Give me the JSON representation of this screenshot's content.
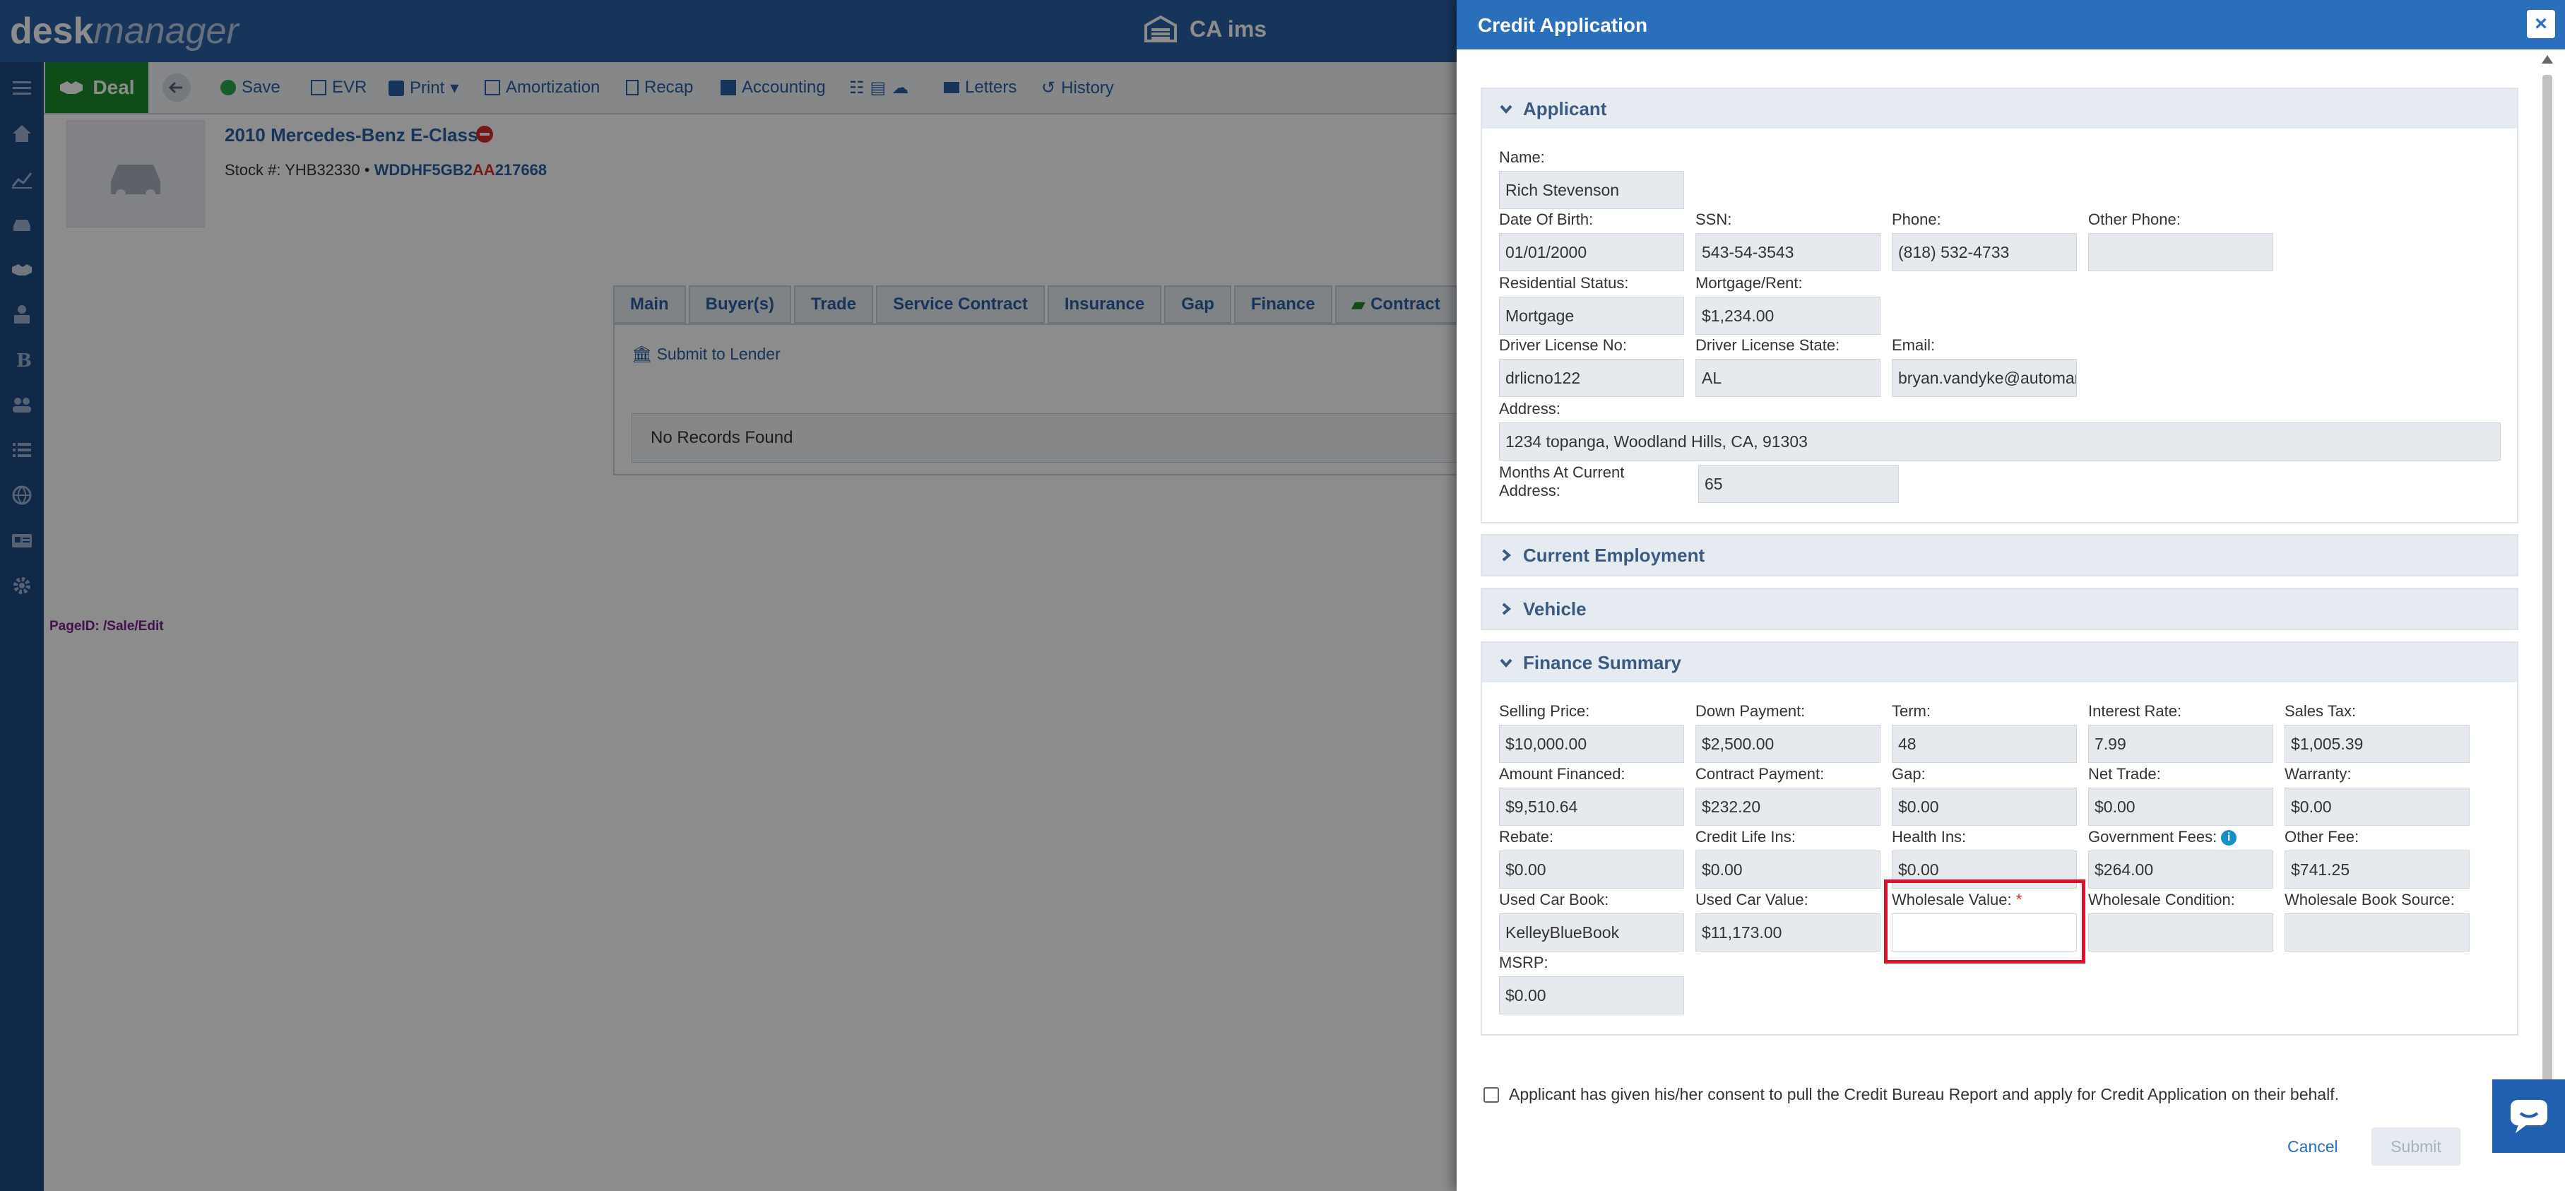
{
  "app": {
    "logo_bold": "desk",
    "logo_light": "manager",
    "dealer_name": "CA ims"
  },
  "actionbar": {
    "deal": "Deal",
    "save": "Save",
    "evr": "EVR",
    "print": "Print",
    "amortization": "Amortization",
    "recap": "Recap",
    "accounting": "Accounting",
    "letters": "Letters",
    "history": "History"
  },
  "vehicle": {
    "title": "2010 Mercedes-Benz E-Class",
    "stock_label": "Stock #:",
    "stock": "YHB32330",
    "vin_a": "WDDHF5GB2",
    "vin_b": "AA",
    "vin_c": "217668"
  },
  "tabs": [
    "Main",
    "Buyer(s)",
    "Trade",
    "Service Contract",
    "Insurance",
    "Gap",
    "Finance",
    "Contract"
  ],
  "tab_panel": {
    "submit_to_lender": "Submit to Lender",
    "no_records": "No Records Found"
  },
  "page_id": "PageID:  /Sale/Edit",
  "modal": {
    "title": "Credit Application",
    "close": "×",
    "sections": {
      "applicant": "Applicant",
      "current_employment": "Current Employment",
      "vehicle": "Vehicle",
      "finance_summary": "Finance Summary"
    },
    "applicant": {
      "name_label": "Name:",
      "name": "Rich  Stevenson",
      "dob_label": "Date Of Birth:",
      "dob": "01/01/2000",
      "ssn_label": "SSN:",
      "ssn": "543-54-3543",
      "phone_label": "Phone:",
      "phone": "(818) 532-4733",
      "other_phone_label": "Other Phone:",
      "other_phone": "",
      "residential_label": "Residential Status:",
      "residential": "Mortgage",
      "mortgage_label": "Mortgage/Rent:",
      "mortgage": "$1,234.00",
      "dl_no_label": "Driver License No:",
      "dl_no": "drlicno122",
      "dl_state_label": "Driver License State:",
      "dl_state": "AL",
      "email_label": "Email:",
      "email": "bryan.vandyke@automar",
      "address_label": "Address:",
      "address": "1234 topanga, Woodland Hills, CA, 91303",
      "months_label_1": "Months At Current",
      "months_label_2": "Address:",
      "months": "65"
    },
    "finance": {
      "selling_price_label": "Selling Price:",
      "selling_price": "$10,000.00",
      "down_payment_label": "Down Payment:",
      "down_payment": "$2,500.00",
      "term_label": "Term:",
      "term": "48",
      "interest_rate_label": "Interest Rate:",
      "interest_rate": "7.99",
      "sales_tax_label": "Sales Tax:",
      "sales_tax": "$1,005.39",
      "amount_financed_label": "Amount Financed:",
      "amount_financed": "$9,510.64",
      "contract_payment_label": "Contract Payment:",
      "contract_payment": "$232.20",
      "gap_label": "Gap:",
      "gap": "$0.00",
      "net_trade_label": "Net Trade:",
      "net_trade": "$0.00",
      "warranty_label": "Warranty:",
      "warranty": "$0.00",
      "rebate_label": "Rebate:",
      "rebate": "$0.00",
      "credit_life_label": "Credit Life Ins:",
      "credit_life": "$0.00",
      "health_label": "Health Ins:",
      "health": "$0.00",
      "gov_fees_label": "Government Fees:",
      "gov_fees": "$264.00",
      "other_fee_label": "Other Fee:",
      "other_fee": "$741.25",
      "used_car_book_label": "Used Car Book:",
      "used_car_book": "KelleyBlueBook",
      "used_car_value_label": "Used Car Value:",
      "used_car_value": "$11,173.00",
      "wholesale_value_label": "Wholesale Value:",
      "wholesale_value": "",
      "required_mark": "*",
      "wholesale_condition_label": "Wholesale Condition:",
      "wholesale_condition": "",
      "wholesale_source_label": "Wholesale Book Source:",
      "wholesale_source": "",
      "msrp_label": "MSRP:",
      "msrp": "$0.00",
      "info_glyph": "i"
    },
    "consent": "Applicant has given his/her consent to pull the Credit Bureau Report and apply for Credit Application on their behalf.",
    "cancel": "Cancel",
    "submit": "Submit"
  },
  "colors": {
    "brand_blue": "#2a5fa4",
    "modal_header": "#2a6fba",
    "deal_green": "#1e8a2f",
    "error_red": "#e0102a"
  }
}
